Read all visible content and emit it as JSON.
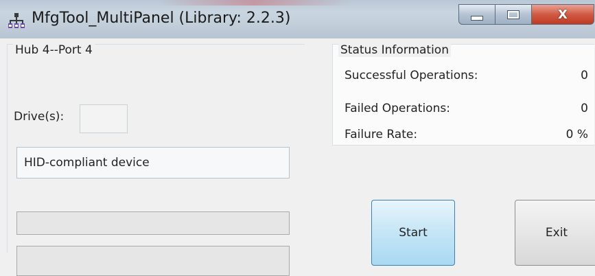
{
  "window": {
    "title": "MfgTool_MultiPanel (Library: 2.2.3)",
    "icon": "usb-hub-icon",
    "controls": {
      "minimize_icon": "minimize-icon",
      "maximize_icon": "maximize-icon",
      "close_label": "X"
    }
  },
  "port_panel": {
    "group_label": "Hub 4--Port 4",
    "drive_label": "Drive(s):",
    "drive_value": "",
    "device_description": "HID-compliant device",
    "progress": [
      0,
      0
    ]
  },
  "status_panel": {
    "group_label": "Status Information",
    "successful_label": "Successful Operations:",
    "successful_value": "0",
    "failed_label": "Failed Operations:",
    "failed_value": "0",
    "failure_rate_label": "Failure Rate:",
    "failure_rate_value": "0 %"
  },
  "buttons": {
    "start_label": "Start",
    "exit_label": "Exit"
  },
  "colors": {
    "close_button": "#c9452d",
    "start_button": "#c4e5f6"
  }
}
